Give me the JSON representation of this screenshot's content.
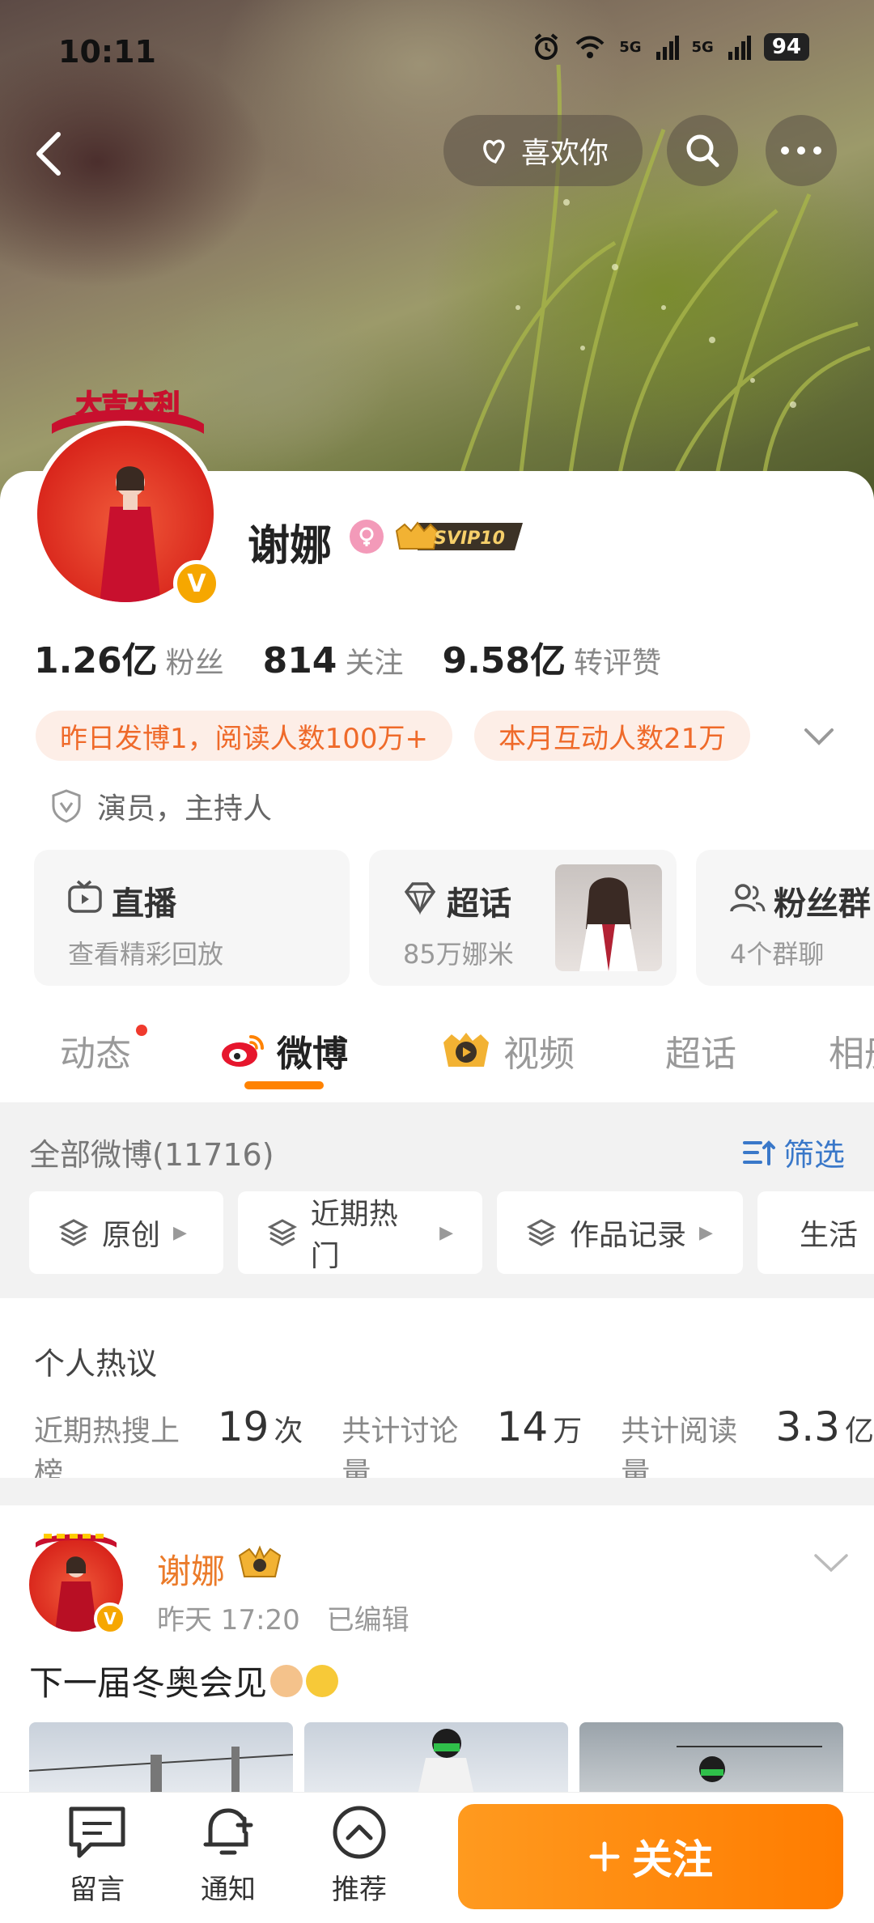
{
  "status_bar": {
    "time": "10:11",
    "signal_1": "5G",
    "signal_2": "5G",
    "battery": "94"
  },
  "nav": {
    "like_label": "喜欢你"
  },
  "profile": {
    "name": "谢娜",
    "vip_badge": "SVIP10",
    "avatar_banner": "大吉大利",
    "verified_letter": "V",
    "stats": [
      {
        "value": "1.26亿",
        "label": "粉丝"
      },
      {
        "value": "814",
        "label": "关注"
      },
      {
        "value": "9.58亿",
        "label": "转评赞"
      }
    ],
    "chips": [
      "昨日发博1，阅读人数100万+",
      "本月互动人数21万"
    ],
    "role": "演员，主持人"
  },
  "tiles": [
    {
      "title": "直播",
      "sub": "查看精彩回放",
      "icon": "tv-icon"
    },
    {
      "title": "超话",
      "sub": "85万娜米",
      "icon": "diamond-icon"
    },
    {
      "title": "粉丝群",
      "sub": "4个群聊",
      "icon": "group-icon"
    }
  ],
  "tabs": [
    "动态",
    "微博",
    "视频",
    "超话",
    "相册"
  ],
  "filter": {
    "all_label": "全部微博(11716)",
    "screen_label": "筛选",
    "chips": [
      "原创",
      "近期热门",
      "作品记录",
      "生活"
    ]
  },
  "hot": {
    "title": "个人热议",
    "items": [
      {
        "label": "近期热搜上榜",
        "num": "19",
        "unit": "次"
      },
      {
        "label": "共计讨论量",
        "num": "14",
        "unit": "万"
      },
      {
        "label": "共计阅读量",
        "num": "3.3",
        "unit": "亿"
      }
    ]
  },
  "post": {
    "author": "谢娜",
    "time": "昨天 17:20",
    "edited": "已编辑",
    "text": "下一届冬奥会见"
  },
  "bottom": {
    "items": [
      "留言",
      "通知",
      "推荐"
    ],
    "follow_label": "关注"
  },
  "colors": {
    "accent": "#ff8200",
    "link": "#3a78c9",
    "chip_text": "#ef6a2a",
    "chip_bg": "#fdeee7"
  }
}
